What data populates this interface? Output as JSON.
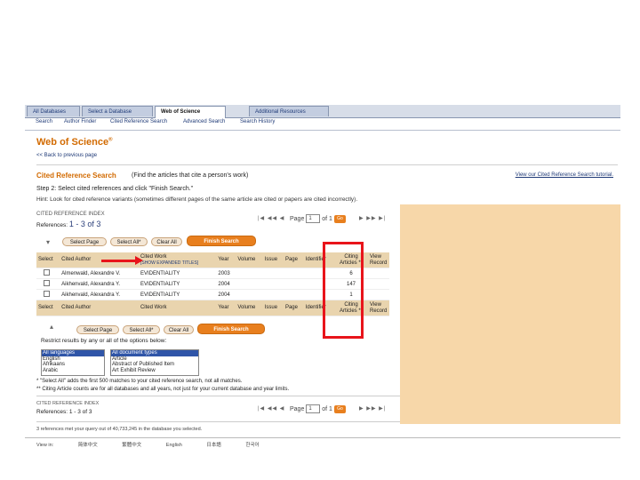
{
  "tabs": [
    {
      "label": "All Databases"
    },
    {
      "label": "Select a Database"
    },
    {
      "label": "Web of Science"
    },
    {
      "label": "Additional Resources"
    }
  ],
  "subnav": [
    "Search",
    "Author Finder",
    "Cited Reference Search",
    "Advanced Search",
    "Search History"
  ],
  "title": "Web of Science",
  "title_mark": "®",
  "back_link": "<< Back to previous page",
  "cited_ref_search": {
    "heading": "Cited Reference Search",
    "subheading": "(Find the articles that cite a person's work)",
    "tutorial_link": "View our Cited Reference Search tutorial."
  },
  "step2": "Step 2: Select cited references and click \"Finish Search.\"",
  "hint": "Hint: Look for cited reference variants (sometimes different pages of the same article are cited or papers are cited incorrectly).",
  "cited_ref_index": {
    "heading": "CITED REFERENCE INDEX",
    "references_prefix": "References:",
    "references_range": "1 - 3 of 3",
    "page_label": "Page",
    "page_value": "1",
    "of_pages": "of 1",
    "go_label": "Go"
  },
  "buttons": {
    "select_page": "Select Page",
    "select_all": "Select All*",
    "clear_all": "Clear All",
    "finish_search": "Finish Search"
  },
  "table": {
    "headers": [
      "Select",
      "Cited Author",
      "Cited Work",
      "Year",
      "Volume",
      "Issue",
      "Page",
      "Identifier",
      "Citing Articles **",
      "View Record"
    ],
    "show_expanded": "[SHOW EXPANDED TITLES]",
    "rows": [
      {
        "author": "Almenwald, Alexandre V.",
        "work": "EVIDENTIALITY",
        "year": "2003",
        "citing": "6"
      },
      {
        "author": "Aikhenvald, Alexandra Y.",
        "work": "EVIDENTIALITY",
        "year": "2004",
        "citing": "147"
      },
      {
        "author": "Aikhenvald, Alexandra Y.",
        "work": "EVIDENTIALITY",
        "year": "2004",
        "citing": "1"
      }
    ]
  },
  "restrict_label": "Restrict results by any or all of the options below:",
  "languages": [
    "All languages",
    "English",
    "Afrikaans",
    "Arabic"
  ],
  "doc_types": [
    "All document types",
    "Article",
    "Abstract of Published Item",
    "Art Exhibit Review"
  ],
  "notes": [
    "* \"Select All\" adds the first 500 matches to your cited reference search, not all matches.",
    "** Citing Article counts are for all databases and all years, not just for your current database and year limits."
  ],
  "bottom_index": {
    "heading": "CITED REFERENCE INDEX",
    "references": "References: 1 - 3 of 3"
  },
  "bottom_note": "3 references met your query out of 40,733,245 in the database you selected.",
  "footer": {
    "view_in": "View in:",
    "languages": [
      "简体中文",
      "繁體中文",
      "English",
      "日本語",
      "한국어"
    ]
  },
  "colors": {
    "accent_orange": "#e87f1e",
    "title_orange": "#d26a00",
    "header_tan": "#e9d4ae",
    "highlight_red": "#e8141b",
    "panel_beige": "#f7d7a9"
  }
}
